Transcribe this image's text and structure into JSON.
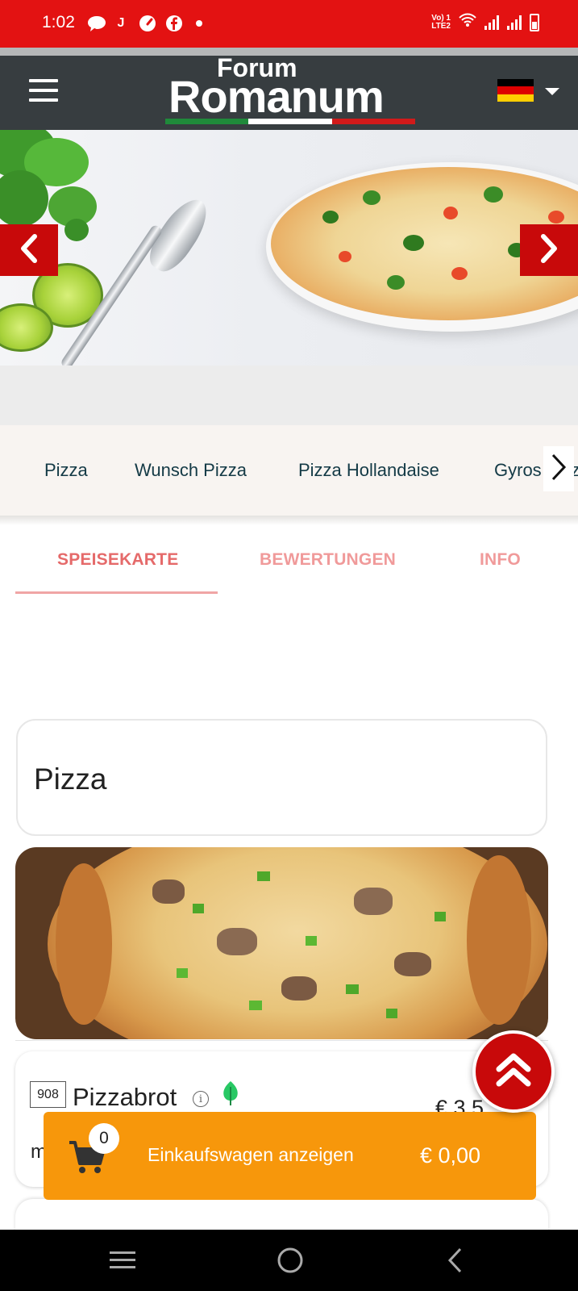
{
  "status_bar": {
    "time": "1:02",
    "notification_icons": [
      "chat-icon",
      "j-app-icon",
      "speedometer-icon",
      "facebook-icon",
      "dot-icon"
    ],
    "system_icons": [
      "volte-icon",
      "wifi-icon",
      "signal-icon",
      "signal-icon",
      "battery-icon"
    ],
    "j_glyph": "J",
    "volte_line1": "Vo) 1",
    "volte_line2": "LTE2",
    "background_color": "#e31212"
  },
  "header": {
    "logo_line1": "Forum",
    "logo_line2": "Romanum",
    "logo_stripe_colors": [
      "#1f8a3a",
      "#ffffff",
      "#d11a1a"
    ],
    "language_flag": "germany-flag-icon",
    "background_color": "#373d40"
  },
  "hero": {
    "prev_icon": "chevron-left-icon",
    "next_icon": "chevron-right-icon",
    "accent_color": "#c8090a"
  },
  "categories": {
    "items": [
      "Pizza",
      "Wunsch Pizza",
      "Pizza Hollandaise",
      "Gyros Pizza"
    ],
    "next_icon": "chevron-right-icon"
  },
  "tabs": [
    {
      "label": "SPEISEKARTE",
      "active": true
    },
    {
      "label": "BEWERTUNGEN",
      "active": false
    },
    {
      "label": "INFO",
      "active": false
    }
  ],
  "section": {
    "title": "Pizza"
  },
  "menu_items": [
    {
      "number": "908",
      "name": "Pizzabrot",
      "price": "€ 3,5",
      "description": "m",
      "info_glyph": "i",
      "icons": [
        "info-icon",
        "leaf-icon"
      ]
    }
  ],
  "cart": {
    "count": "0",
    "label": "Einkaufswagen anzeigen",
    "total": "€ 0,00",
    "background_color": "#f7970b"
  },
  "scroll_top_icon": "double-chevron-up-icon",
  "nav_bar": {
    "icons": [
      "recent-apps-icon",
      "home-icon",
      "back-icon"
    ]
  }
}
